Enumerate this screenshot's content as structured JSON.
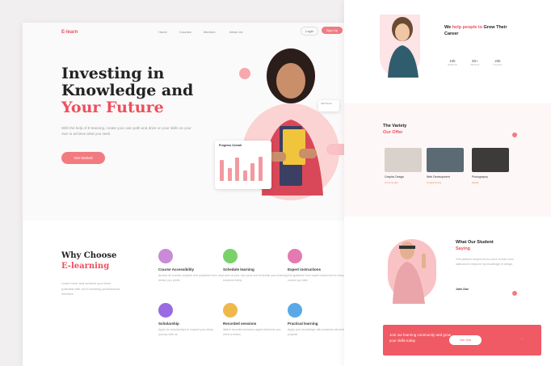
{
  "brand": {
    "logo": "E-learn"
  },
  "nav": {
    "items": [
      "Home",
      "Courses",
      "Mentors",
      "About Us"
    ],
    "login": "Login",
    "signup": "Sign Up"
  },
  "hero": {
    "title_line1": "Investing in",
    "title_line2": "Knowledge and",
    "title_accent": "Your Future",
    "subtitle": "With the help of E-learning, create your own path and drive on your skills on your own to achieve what you seek.",
    "cta": "Get Started",
    "progress_card_title": "Progress Overall",
    "progress_bars": [
      0.8,
      0.5,
      0.9,
      0.4,
      0.7,
      0.95
    ],
    "badge_text": "Skill Score"
  },
  "why": {
    "title": "Why Choose",
    "title_accent": "E-learning",
    "subtitle": "Learn more and achieve your best potential with our E-learning professional mentors.",
    "features": [
      {
        "title": "Course Accessibility",
        "desc": "Access all courses anytime and anywhere from any device you prefer.",
        "color": "#c98ad8",
        "icon": "book-icon"
      },
      {
        "title": "Schedule learning",
        "desc": "Learn at your own pace and schedule your learning sessions freely.",
        "color": "#7ad16a",
        "icon": "calendar-icon"
      },
      {
        "title": "Expert instructions",
        "desc": "Get guidance from expert instructors in every course you take.",
        "color": "#e57ab0",
        "icon": "user-icon"
      },
      {
        "title": "Scholarship",
        "desc": "Apply for scholarships to support your study journey with us.",
        "color": "#9a6be0",
        "icon": "cap-icon"
      },
      {
        "title": "Recorded sessions",
        "desc": "Watch recorded sessions again whenever you need a review.",
        "color": "#f0b84a",
        "icon": "video-icon"
      },
      {
        "title": "Practical learning",
        "desc": "Apply your knowledge with practical real-world projects.",
        "color": "#5aa8e8",
        "icon": "tool-icon"
      }
    ]
  },
  "side": {
    "intro_title_a": "We",
    "intro_title_acc": "help people to",
    "intro_title_b": "Grow Their Career",
    "stats": [
      {
        "value": "10k",
        "label": "Students"
      },
      {
        "value": "50+",
        "label": "Mentors"
      },
      {
        "value": "20k",
        "label": "Courses"
      }
    ],
    "variety_title": "The Variety",
    "variety_acc": "Our Offer",
    "courses": [
      {
        "title": "Graphic Design",
        "meta": "Art & Design"
      },
      {
        "title": "Web Development",
        "meta": "Programming"
      },
      {
        "title": "Photography",
        "meta": "Media"
      }
    ],
    "testimonial_title": "What Our Student",
    "testimonial_acc": "Saying",
    "testimonial_text": "This platform helped me so much to learn new skills and to improve my knowledge in design.",
    "testimonial_name": "John Doe",
    "banner_text": "Join our learning community and grow your skills today",
    "banner_btn": "Join Now"
  },
  "colors": {
    "accent": "#ef4e5d",
    "soft": "#fbd3d3"
  }
}
